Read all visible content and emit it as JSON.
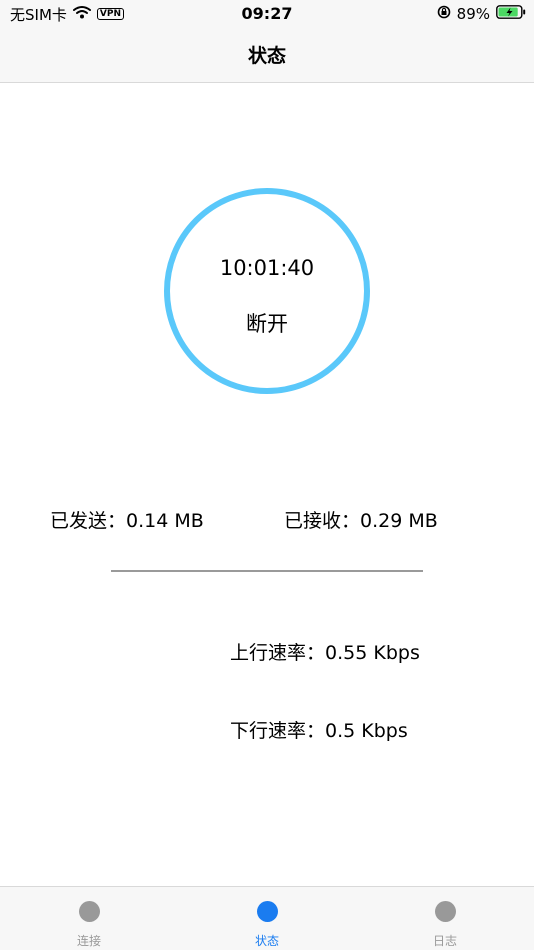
{
  "status_bar": {
    "carrier": "无SIM卡",
    "vpn": "VPN",
    "time": "09:27",
    "battery_percent": "89%",
    "battery_level": 0.89
  },
  "nav": {
    "title": "状态"
  },
  "timer": {
    "elapsed": "10:01:40",
    "status": "断开"
  },
  "stats": {
    "sent_label": "已发送：",
    "sent_value": "0.14 MB",
    "received_label": "已接收：",
    "received_value": "0.29 MB",
    "upload_label": "上行速率：",
    "upload_value": "0.55 Kbps",
    "download_label": "下行速率：",
    "download_value": "0.5 Kbps"
  },
  "tabs": [
    {
      "label": "连接",
      "active": false
    },
    {
      "label": "状态",
      "active": true
    },
    {
      "label": "日志",
      "active": false
    }
  ],
  "colors": {
    "accent": "#5ac8fa",
    "tab_active": "#1a7cf0",
    "tab_inactive": "#999999",
    "battery_fill": "#4cd964"
  }
}
